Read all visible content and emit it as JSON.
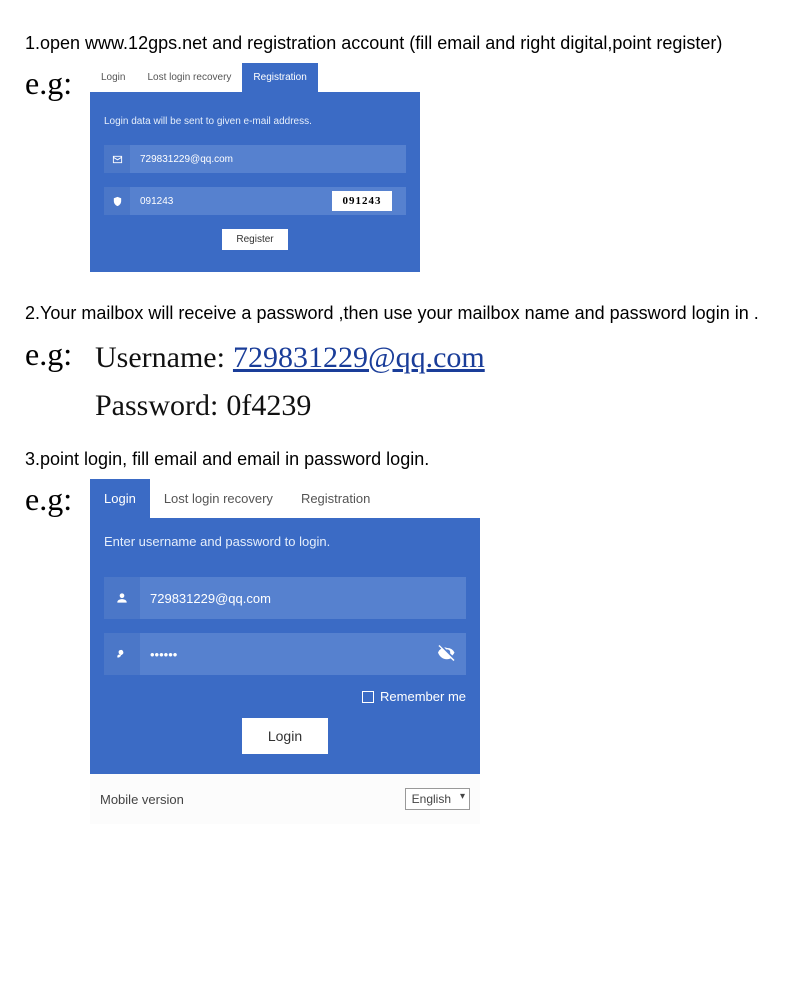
{
  "steps": {
    "s1": "1.open www.12gps.net and registration account (fill email and right digital,point register)",
    "s2": "2.Your mailbox will receive a password ,then use your mailbox name and password login in .",
    "s3": "3.point login, fill email and email in password login."
  },
  "eg": "e.g:",
  "registration": {
    "tabs": {
      "login": "Login",
      "recovery": "Lost login recovery",
      "registration": "Registration"
    },
    "instruction": "Login data will be sent to given e-mail address.",
    "email": "729831229@qq.com",
    "captcha_input": "091243",
    "captcha_image": "091243",
    "button": "Register"
  },
  "credentials": {
    "username_label": "Username:",
    "username_value": "729831229@qq.com",
    "password_label": "Password:",
    "password_value": "0f4239"
  },
  "login": {
    "tabs": {
      "login": "Login",
      "recovery": "Lost login recovery",
      "registration": "Registration"
    },
    "instruction": "Enter username and password to login.",
    "username": "729831229@qq.com",
    "password": "••••••",
    "remember": "Remember me",
    "button": "Login",
    "mobile": "Mobile version",
    "language": "English"
  }
}
